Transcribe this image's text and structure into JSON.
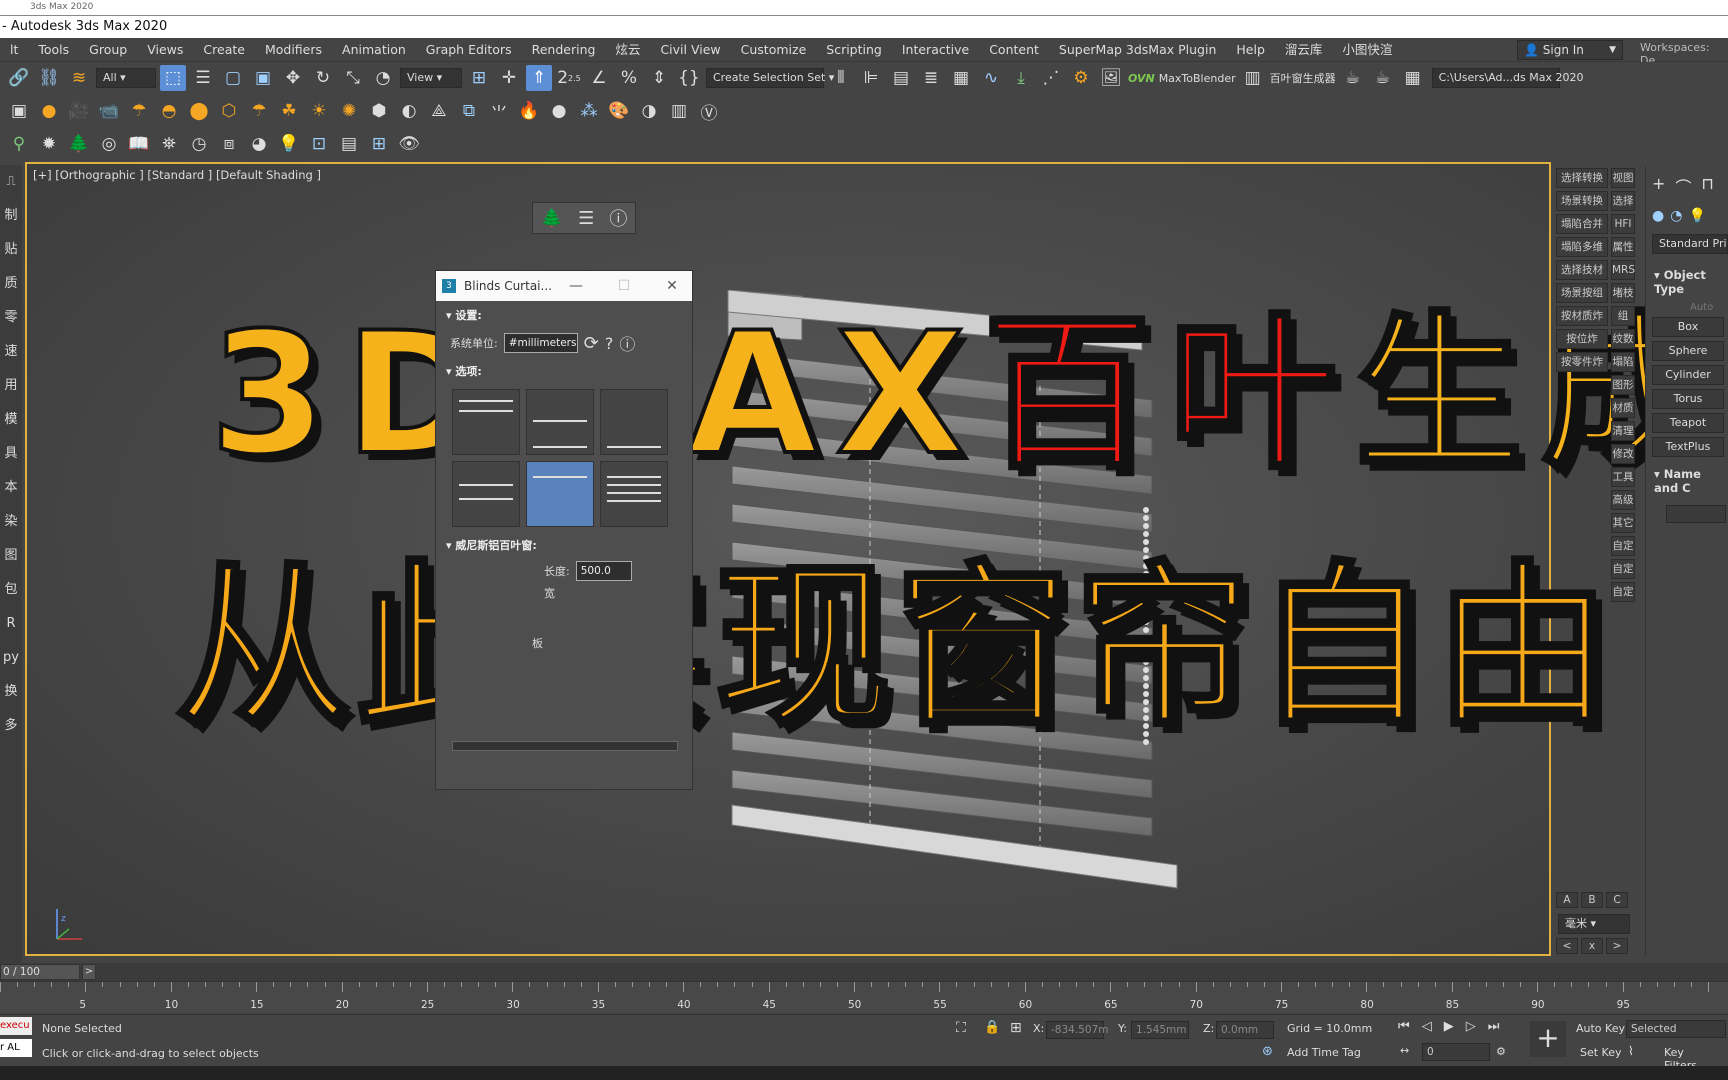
{
  "top_strip_text": "3ds Max 2020",
  "title": "- Autodesk 3ds Max 2020",
  "menu": [
    "lt",
    "Tools",
    "Group",
    "Views",
    "Create",
    "Modifiers",
    "Animation",
    "Graph Editors",
    "Rendering",
    "炫云",
    "Civil View",
    "Customize",
    "Scripting",
    "Interactive",
    "Content",
    "SuperMap 3dsMax Plugin",
    "Help",
    "溜云库",
    "小图快渲"
  ],
  "signin": "Sign In",
  "workspaces": "Workspaces: De",
  "toolbar": {
    "filter": "All",
    "refcoord": "View",
    "selset": "Create Selection Set",
    "ovn": "OVN",
    "maxtoblender": "MaxToBlender",
    "blindsgen": "百叶窗生成器",
    "path": "C:\\Users\\Ad...ds Max 2020",
    "angle": "2.5"
  },
  "left_chars": [
    "制",
    "贴",
    "质",
    "零",
    "速",
    "用",
    "模",
    "具",
    "本",
    "染",
    "图",
    "包",
    "R",
    "py",
    "换",
    "多"
  ],
  "viewport_label": "[+] [Orthographic ] [Standard ] [Default Shading ]",
  "overlay": {
    "line1_a": "3DMAX",
    "line1_b": "百叶",
    "line1_c": "生成",
    "line2": "从此实现窗帘自由"
  },
  "blinds_dialog": {
    "title": "Blinds Curtai...",
    "settings": "设置:",
    "unit_label": "系统单位:",
    "unit_value": "#millimeters",
    "options": "选项:",
    "venetian": "威尼斯铝百叶窗:",
    "length_label": "长度:",
    "length_value": "500.0",
    "width_label": "宽",
    "slat_label": "板"
  },
  "right_tools_left": [
    "选择转换",
    "场景转换",
    "塌陷合并",
    "塌陷多维",
    "选择技材",
    "场景按组",
    "按材质炸",
    "按位炸",
    "按零件炸"
  ],
  "right_tools_right": [
    "视图",
    "选择",
    "HFI",
    "属性",
    "MRS",
    "堵枝",
    "组",
    "纹数",
    "塌陷",
    "图形",
    "材质",
    "清理",
    "修改",
    "工具",
    "高级",
    "其它",
    "自定",
    "自定",
    "自定"
  ],
  "abc": [
    "A",
    "B",
    "C"
  ],
  "unit_select": "毫米",
  "nav": [
    "<",
    "x",
    ">"
  ],
  "cmd_panel": {
    "category": "Standard Primitiv",
    "object_type": "Object Type",
    "autogrid": "Auto",
    "buttons": [
      "Box",
      "Sphere",
      "Cylinder",
      "Torus",
      "Teapot",
      "TextPlus"
    ],
    "name_color": "Name and C"
  },
  "time": {
    "frame": "0 / 100",
    "ticks": [
      "5",
      "10",
      "15",
      "20",
      "25",
      "30",
      "35",
      "40",
      "45",
      "50",
      "55",
      "60",
      "65",
      "70",
      "75",
      "80",
      "85",
      "90",
      "95"
    ]
  },
  "status": {
    "script1": "execu",
    "script2": "r AL",
    "selection": "None Selected",
    "prompt": "Click or click-and-drag to select objects",
    "x_label": "X:",
    "x_value": "-834.507m",
    "y_label": "Y:",
    "y_value": "1.545mm",
    "z_label": "Z:",
    "z_value": "0.0mm",
    "grid": "Grid = 10.0mm",
    "add_time_tag": "Add Time Tag",
    "auto_key": "Auto Key",
    "selected": "Selected",
    "set_key": "Set Key",
    "key_filters": "Key Filters...",
    "frame_value": "0"
  }
}
